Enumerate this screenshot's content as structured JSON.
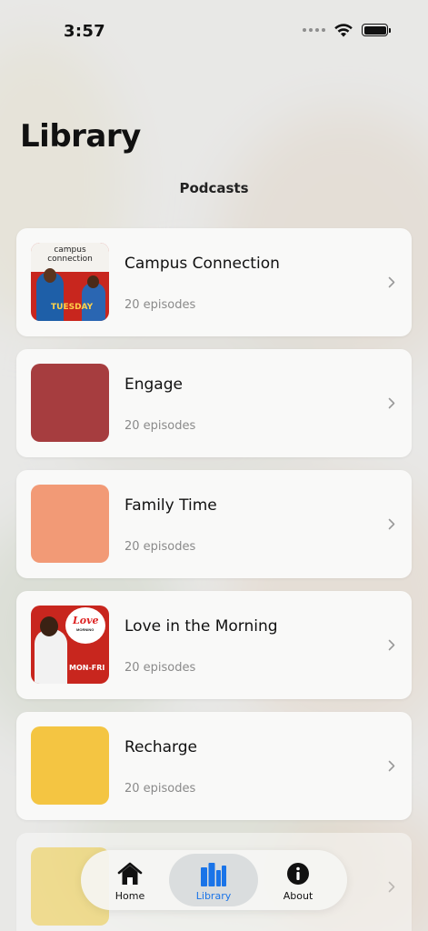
{
  "status_bar": {
    "time": "3:57"
  },
  "page": {
    "title": "Library",
    "section_title": "Podcasts"
  },
  "podcasts": [
    {
      "name": "Campus Connection",
      "episodes": "20 episodes",
      "cover_text": [
        "campus",
        "connection",
        "TUESDAY"
      ]
    },
    {
      "name": "Engage",
      "episodes": "20 episodes",
      "cover_color": "#a63d3f"
    },
    {
      "name": "Family Time",
      "episodes": "20 episodes",
      "cover_color": "#f29a76"
    },
    {
      "name": "Love in the Morning",
      "episodes": "20 episodes",
      "cover_text": [
        "Love",
        "MORNING",
        "MON-FRI"
      ]
    },
    {
      "name": "Recharge",
      "episodes": "20 episodes",
      "cover_color": "#f4c542"
    },
    {
      "name": "",
      "episodes": "",
      "cover_color": "#f5d24a"
    }
  ],
  "tab_bar": {
    "tabs": [
      {
        "label": "Home",
        "icon": "house-icon",
        "selected": false
      },
      {
        "label": "Library",
        "icon": "books-icon",
        "selected": true
      },
      {
        "label": "About",
        "icon": "info-icon",
        "selected": false
      }
    ]
  },
  "colors": {
    "accent": "#1a74e8",
    "secondary_text": "#8a8a8a"
  }
}
